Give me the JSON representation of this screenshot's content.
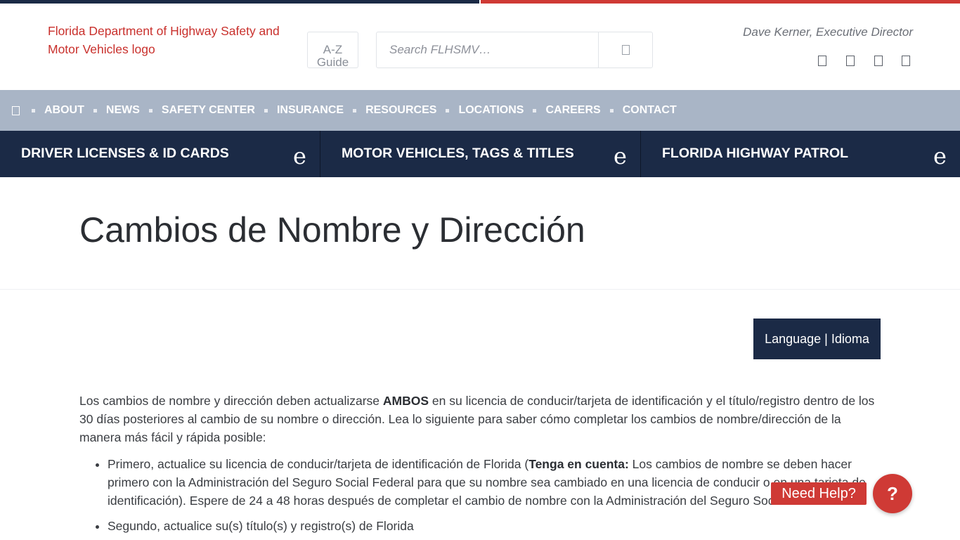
{
  "header": {
    "logo_alt": "Florida Department of Highway Safety and Motor Vehicles logo",
    "az_line1": "A-Z",
    "az_line2": "Guide",
    "search_placeholder": "Search FLHSMV…",
    "director": "Dave Kerner, Executive Director"
  },
  "nav": {
    "items": [
      "ABOUT",
      "NEWS",
      "SAFETY CENTER",
      "INSURANCE",
      "RESOURCES",
      "LOCATIONS",
      "CAREERS",
      "CONTACT"
    ]
  },
  "categories": [
    {
      "label": "DRIVER LICENSES & ID CARDS",
      "icon": "e"
    },
    {
      "label": "MOTOR VEHICLES, TAGS & TITLES",
      "icon": "e"
    },
    {
      "label": "FLORIDA HIGHWAY PATROL",
      "icon": "e"
    }
  ],
  "page": {
    "title": "Cambios de Nombre y Dirección",
    "language_button": "Language | Idioma"
  },
  "content": {
    "intro_before": "Los cambios de nombre y dirección deben actualizarse ",
    "intro_bold": "AMBOS",
    "intro_after": " en su licencia de conducir/tarjeta de identificación y el título/registro dentro de los 30 días posteriores al cambio de su nombre o dirección. Lea lo siguiente para saber cómo completar los cambios de nombre/dirección de la manera más fácil y rápida posible:",
    "bullet1_before": "Primero, actualice su licencia de conducir/tarjeta de identificación de Florida (",
    "bullet1_bold": "Tenga en cuenta:",
    "bullet1_after": " Los cambios de nombre se deben hacer primero con la Administración del Seguro Social Federal para que su nombre sea cambiado en una licencia de conducir o en una tarjeta de identificación). Espere de 24 a 48 horas después de completar el cambio de nombre con la Administración del Seguro Social.",
    "bullet2": "Segundo, actualice su(s) título(s) y registro(s) de Florida"
  },
  "help": {
    "label": "Need Help?",
    "circle": "?"
  },
  "colors": {
    "navy": "#1b2a46",
    "red": "#cf3a35",
    "nav_gray": "#a9b5c6"
  }
}
